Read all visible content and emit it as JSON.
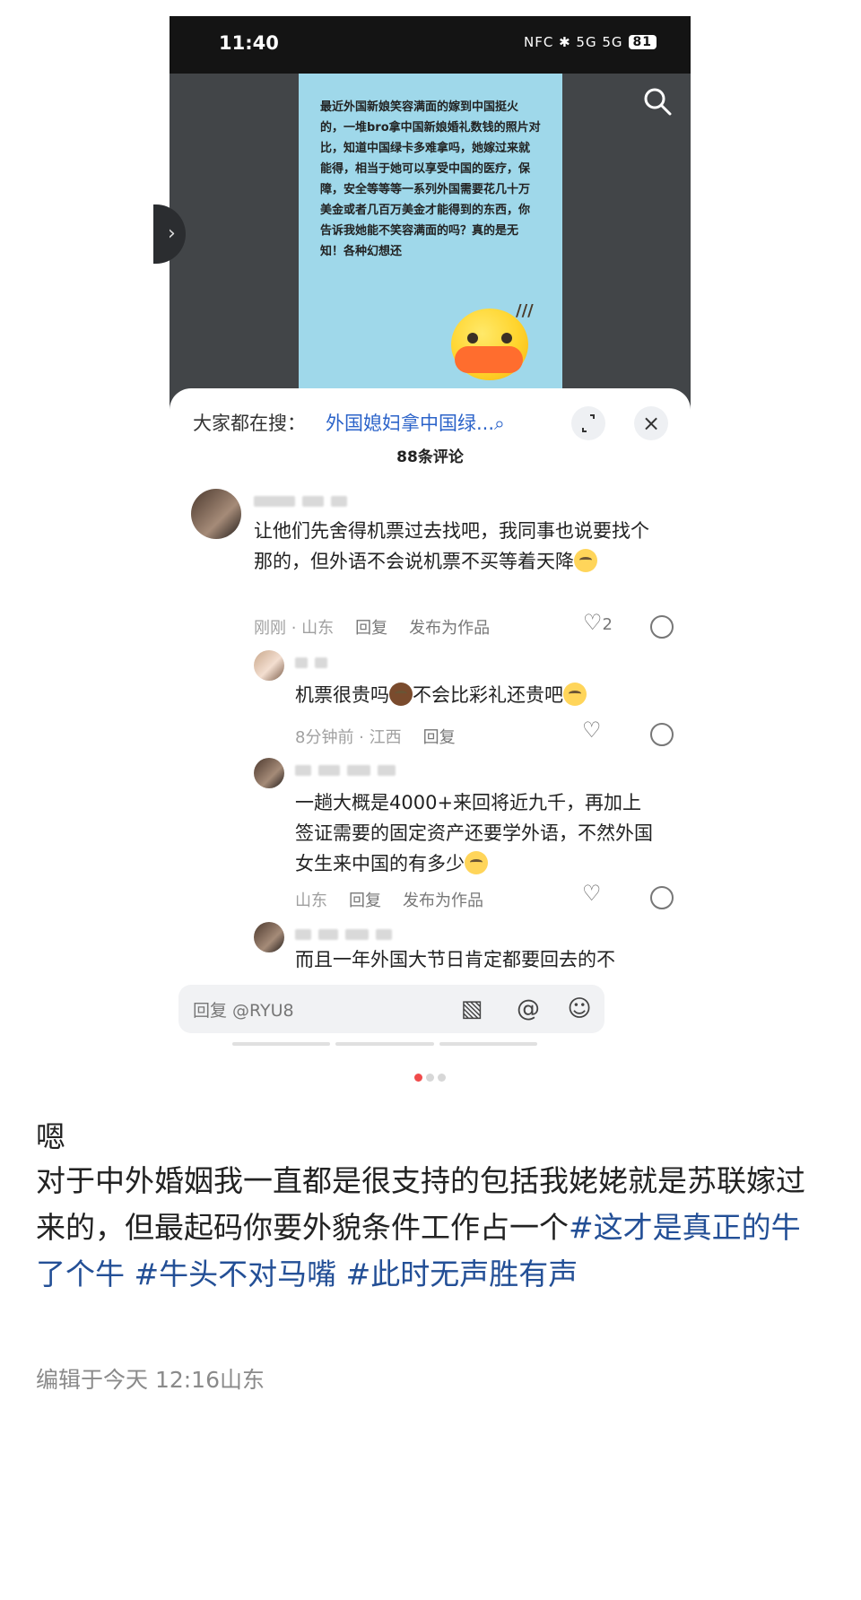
{
  "statusbar": {
    "time": "11:40",
    "icons": "NFC ✱ 5G 5G",
    "battery": "81"
  },
  "image_card": {
    "text": "最近外国新娘笑容满面的嫁到中国挺火的，一堆bro拿中国新娘婚礼数钱的照片对比，知道中国绿卡多难拿吗，她嫁过来就能得，相当于她可以享受中国的医疗，保障，安全等等等一系列外国需要花几十万美金或者几百万美金才能得到的东西，你告诉我她能不笑容满面的吗？真的是无知！各种幻想还"
  },
  "panel": {
    "search_label": "大家都在搜：",
    "search_query": "外国媳妇拿中国绿...",
    "comment_count": "88条评论",
    "comments": [
      {
        "text": "让他们先舍得机票过去找吧，我同事也说要找个那的，但外语不会说机票不买等着天降",
        "time": "刚刚 · 山东",
        "reply": "回复",
        "publish": "发布为作品",
        "likes": "2"
      },
      {
        "text_before": "机票很贵吗",
        "text_after": "不会比彩礼还贵吧",
        "time": "8分钟前 · 江西",
        "reply": "回复"
      },
      {
        "text": "一趟大概是4000+来回将近九千，再加上签证需要的固定资产还要学外语，不然外国女生来中国的有多少",
        "time": "山东",
        "reply": "回复",
        "publish": "发布为作品"
      },
      {
        "text": "而且一年外国大节日肯定都要回去的不"
      }
    ],
    "input_placeholder": "回复 @RYU8"
  },
  "post": {
    "ending": "嗯",
    "body_text": "对于中外婚姻我一直都是很支持的包括我姥姥就是苏联嫁过来的，但最起码你要外貌条件工作占一个",
    "hashtags": [
      "#这才是真正的牛了个牛 ",
      "#牛头不对马嘴 ",
      "#此时无声胜有声"
    ],
    "edited": "编辑于今天 12:16山东"
  },
  "colors": {
    "link": "#2b63c9",
    "hashtag": "#234f96",
    "image_bg": "#9fd8ea",
    "active_dot": "#f04b4b"
  }
}
